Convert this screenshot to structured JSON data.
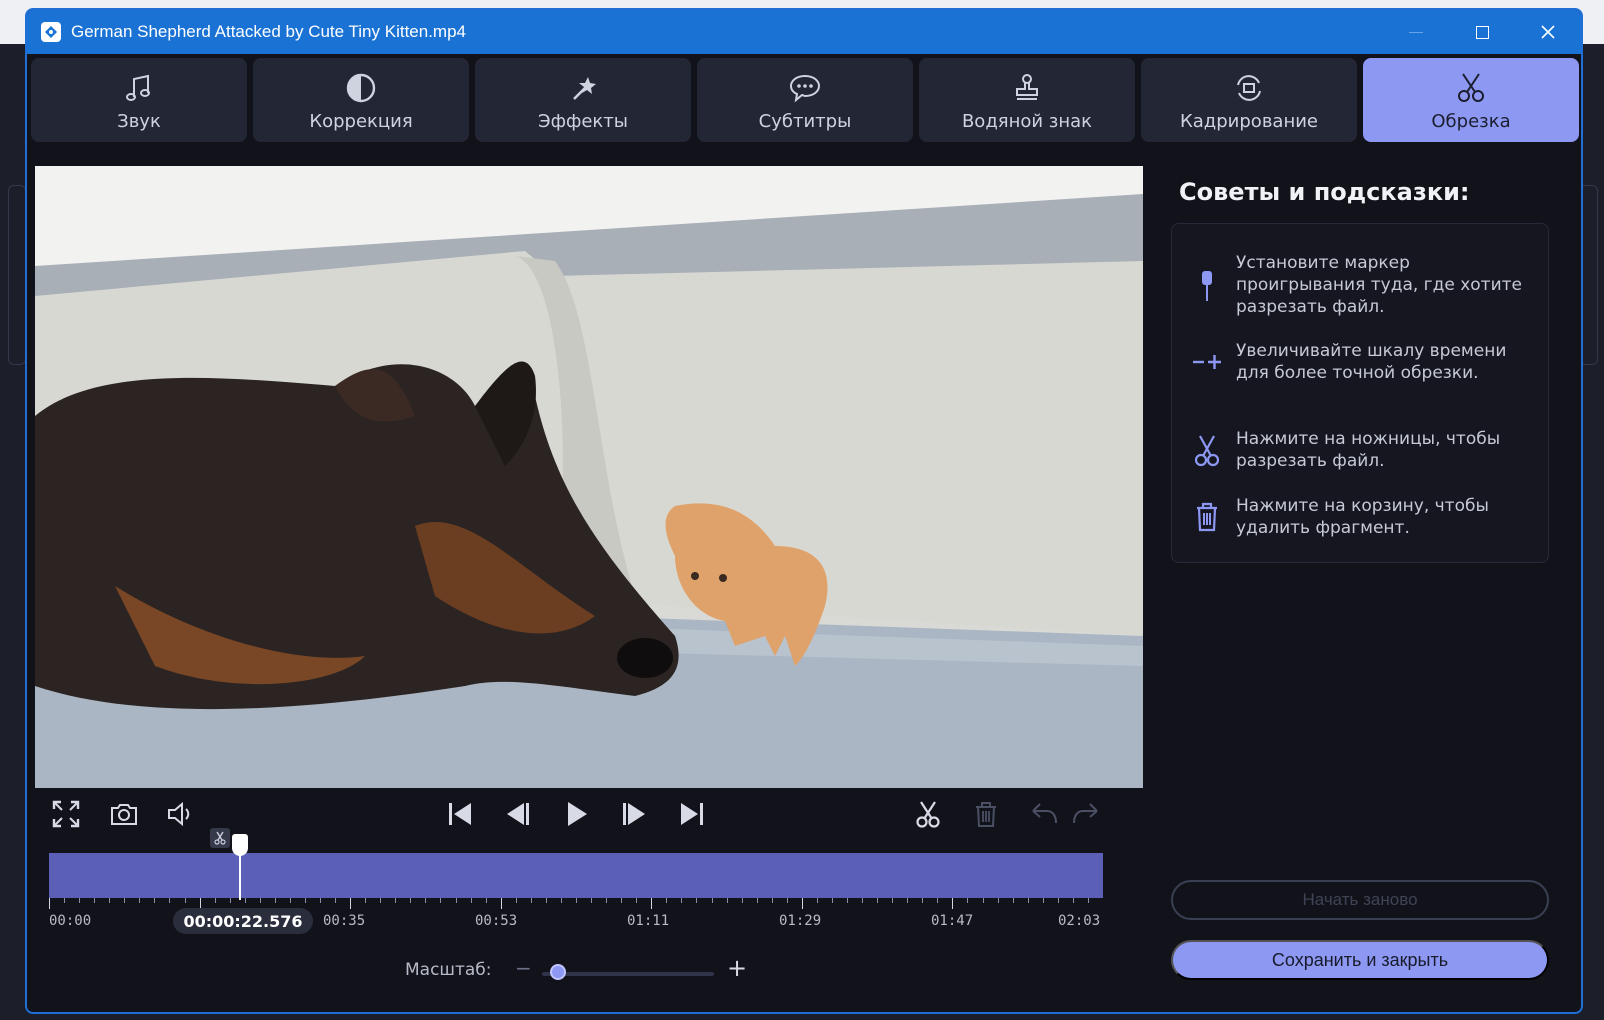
{
  "window": {
    "title": "German Shepherd Attacked by Cute Tiny Kitten.mp4",
    "accent_color": "#1a73d4"
  },
  "tabs": [
    {
      "label": "Звук",
      "icon": "music-note-icon",
      "active": false
    },
    {
      "label": "Коррекция",
      "icon": "contrast-icon",
      "active": false
    },
    {
      "label": "Эффекты",
      "icon": "magic-wand-icon",
      "active": false
    },
    {
      "label": "Субтитры",
      "icon": "speech-bubble-icon",
      "active": false
    },
    {
      "label": "Водяной знак",
      "icon": "stamp-icon",
      "active": false
    },
    {
      "label": "Кадрирование",
      "icon": "crop-rotate-icon",
      "active": false
    },
    {
      "label": "Обрезка",
      "icon": "scissors-icon",
      "active": true
    }
  ],
  "tips": {
    "title": "Советы и подсказки:",
    "items": [
      {
        "icon": "marker-icon",
        "text": "Установите маркер проигрывания туда, где хотите разрезать файл."
      },
      {
        "icon": "zoom-timeline-icon",
        "text": "Увеличивайте шкалу времени для более точной обрезки."
      },
      {
        "icon": "scissors-icon",
        "text": "Нажмите на ножницы, чтобы разрезать файл."
      },
      {
        "icon": "trash-icon",
        "text": "Нажмите на корзину, чтобы удалить фрагмент."
      }
    ]
  },
  "buttons": {
    "restart": "Начать заново",
    "save_close": "Сохранить и закрыть"
  },
  "timeline": {
    "current_time": "00:00:22.576",
    "ticks": [
      "00:00",
      "00:35",
      "00:53",
      "01:11",
      "01:29",
      "01:47",
      "02:03"
    ],
    "playhead_fraction": 0.18
  },
  "zoom": {
    "label": "Масштаб:",
    "minus": "−",
    "plus": "+",
    "level": 0.05
  },
  "colors": {
    "track": "#5b5fb8",
    "active_tab": "#8d98f3",
    "panel_bg": "#12131a"
  }
}
